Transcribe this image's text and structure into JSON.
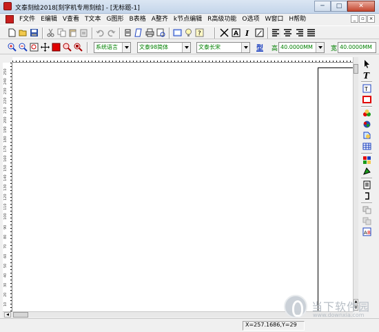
{
  "window": {
    "title": "文泰刻绘2018[刻字机专用刻绘] - [无标题-1]",
    "min_label": "─",
    "max_label": "□",
    "close_label": "✕"
  },
  "menu": {
    "items": [
      "F文件",
      "E编辑",
      "V查看",
      "T文本",
      "G图形",
      "B表格",
      "A整齐",
      "k节点编辑",
      "R高级功能",
      "O选项",
      "W窗口",
      "H帮助"
    ],
    "mdi_min": "_",
    "mdi_restore": "▫",
    "mdi_close": "×"
  },
  "toolbar1": {
    "icons": [
      "new-file-icon",
      "open-folder-icon",
      "save-icon",
      "cut-icon",
      "copy-icon",
      "paste-icon",
      "paste-special-icon",
      "undo-icon",
      "redo-icon",
      "print-preview-icon",
      "output-icon",
      "print-icon",
      "cut-preview-icon",
      "frame-icon",
      "bulb-icon",
      "help-icon",
      "transform-icon",
      "text-box-icon",
      "italic-icon",
      "edit-text-icon",
      "align-left-icon",
      "align-center-icon",
      "align-right-icon",
      "justify-icon"
    ]
  },
  "toolbar2": {
    "language_combo": "系统语言",
    "font_combo": "文泰98简体",
    "style_combo": "文泰长宋",
    "shape_label": "型",
    "height_label": "高",
    "height_value": "40.0000MM",
    "width_label": "宽",
    "width_value": "40.0000MM"
  },
  "ruler": {
    "left_numbers": [
      "250",
      "240",
      "230",
      "220",
      "210",
      "200",
      "190",
      "180",
      "170",
      "160",
      "150",
      "140",
      "130",
      "120",
      "110",
      "100",
      "90",
      "80",
      "70",
      "60",
      "50",
      "40",
      "30",
      "20",
      "10"
    ]
  },
  "right_tools": [
    "select-arrow-icon",
    "text-tool-icon",
    "vertical-text-icon",
    "rectangle-icon",
    "color-fill-icon",
    "color-palette-icon",
    "shape-icon",
    "table-icon",
    "grid-color-icon",
    "outline-icon",
    "document-icon",
    "bracket-icon",
    "weld-icon",
    "combine-icon",
    "text-ab-icon"
  ],
  "status": {
    "coords": "X=257.1686,Y=29"
  },
  "watermark": {
    "text": "当下软件园",
    "url": "www.downxia.com"
  }
}
